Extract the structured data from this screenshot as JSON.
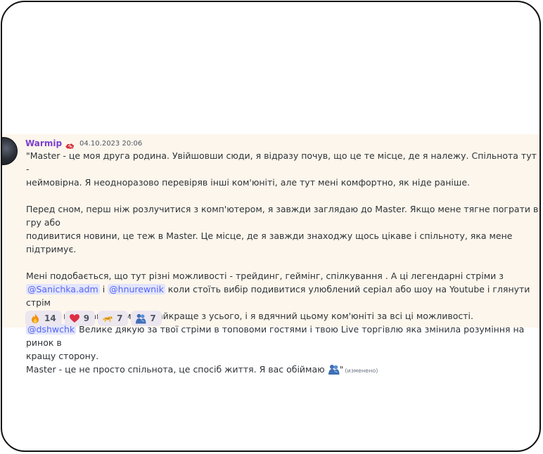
{
  "message": {
    "author": "Warmip",
    "author_color": "#7a3fd1",
    "author_badge_icon": "clouds-icon",
    "timestamp": "04.10.2023 20:06",
    "lines": {
      "l1": "\"Master - це моя друга родина. Увійшовши сюди, я відразу почув, що це те місце, де я належу. Спільнота тут -",
      "l2": "неймовірна. Я неодноразово перевіряв інші ком'юніті, але тут мені комфортно, як ніде раніше.",
      "l3": "Перед сном, перш ніж розлучитися з комп'ютером, я завжди заглядаю до Master. Якщо мене тягне пограти в гру або",
      "l4": "подивитися новини, це теж в Master. Це місце, де я завжди знаходжу щось цікаве і спільноту, яка мене підтримує.",
      "l5": "Мені подобається, що тут різні можливості - трейдинг, геймінг, спілкування . А ці легендарні стріми з",
      "l6_mention1": "@Sanichka.adm",
      "l6_between": " і ",
      "l6_mention2": "@hnurewnik",
      "l6_rest": " коли стоїть вибір подивитися улюблений серіал або шоу на Youtube і глянути стрім",
      "l7": "відразу вибираю стрім. Це найкраще з усього, і я вдячний цьому ком'юніті за всі ці можливості.",
      "l8_mention": "@dshwchk",
      "l8_rest": "  Велике дякую за твої стріми в топовоми гостями і твою Live торгівлю яка змінила розуміння на ринок в",
      "l9": "кращу сторону.",
      "l10": "Master - це не просто спільнота, це спосіб життя. Я вас обіймаю ",
      "l10_emoji_icon": "people-hugging-icon",
      "l10_end": "\"",
      "edited": "(изменено)"
    },
    "mention_color": "#5865f2"
  },
  "reactions": [
    {
      "icon": "fire-icon",
      "count": "14"
    },
    {
      "icon": "red-heart-icon",
      "count": "9"
    },
    {
      "icon": "leopard-icon",
      "count": "7"
    },
    {
      "icon": "people-hugging-icon",
      "count": "7"
    }
  ]
}
